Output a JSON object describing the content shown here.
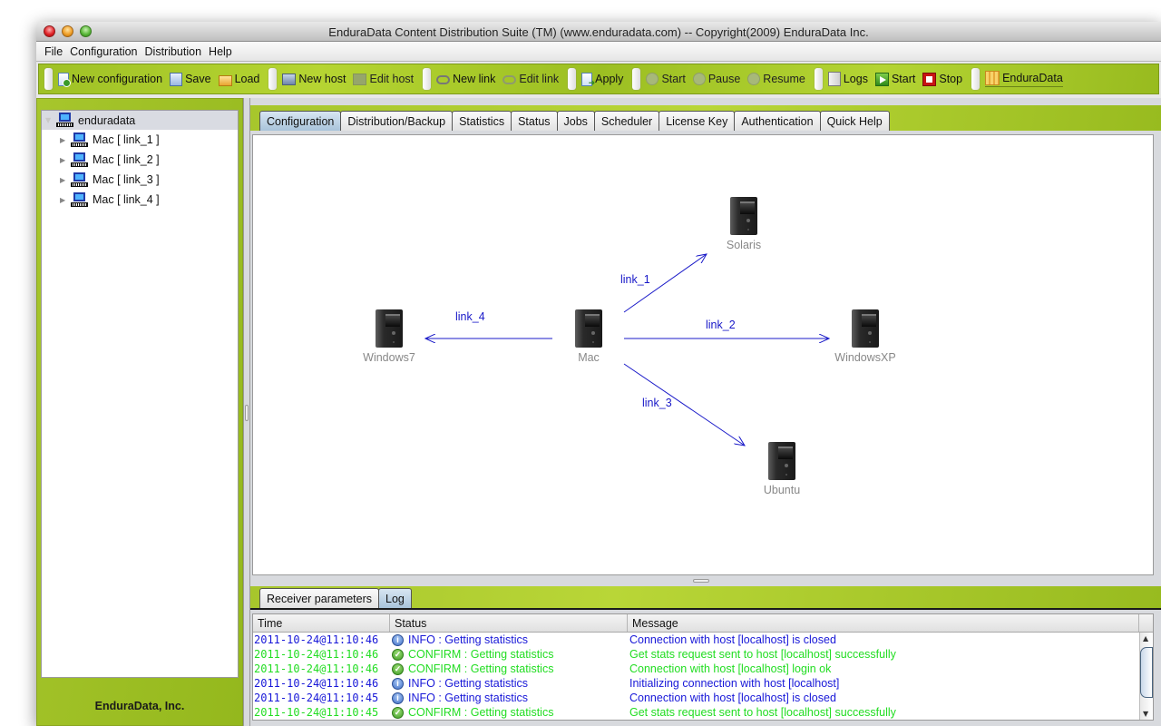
{
  "window": {
    "title": "EnduraData Content Distribution Suite (TM) (www.enduradata.com) -- Copyright(2009) EnduraData Inc."
  },
  "menu": [
    "File",
    "Configuration",
    "Distribution",
    "Help"
  ],
  "toolbar": {
    "groups": [
      [
        {
          "label": "New configuration",
          "icon": "new-document-icon",
          "enabled": true
        },
        {
          "label": "Save",
          "icon": "save-icon",
          "enabled": true
        },
        {
          "label": "Load",
          "icon": "folder-open-icon",
          "enabled": true
        }
      ],
      [
        {
          "label": "New host",
          "icon": "new-host-icon",
          "enabled": true
        },
        {
          "label": "Edit host",
          "icon": "edit-host-icon",
          "enabled": false
        }
      ],
      [
        {
          "label": "New link",
          "icon": "new-link-icon",
          "enabled": true
        },
        {
          "label": "Edit link",
          "icon": "edit-link-icon",
          "enabled": false
        }
      ],
      [
        {
          "label": "Apply",
          "icon": "apply-icon",
          "enabled": true
        }
      ],
      [
        {
          "label": "Start",
          "icon": "start-circle-icon",
          "enabled": false
        },
        {
          "label": "Pause",
          "icon": "pause-circle-icon",
          "enabled": false
        },
        {
          "label": "Resume",
          "icon": "resume-circle-icon",
          "enabled": false
        }
      ],
      [
        {
          "label": "Logs",
          "icon": "logs-icon",
          "enabled": true
        },
        {
          "label": "Start",
          "icon": "play-icon",
          "enabled": true
        },
        {
          "label": "Stop",
          "icon": "stop-icon",
          "enabled": true
        }
      ],
      [
        {
          "label": "EnduraData",
          "icon": "enduradata-logo-icon",
          "enabled": true
        }
      ]
    ]
  },
  "tree": {
    "root": "enduradata",
    "children": [
      "Mac [ link_1 ]",
      "Mac [ link_2 ]",
      "Mac [ link_3 ]",
      "Mac [ link_4 ]"
    ]
  },
  "company": "EnduraData, Inc.",
  "tabs": [
    "Configuration",
    "Distribution/Backup",
    "Statistics",
    "Status",
    "Jobs",
    "Scheduler",
    "License Key",
    "Authentication",
    "Quick Help"
  ],
  "active_tab": "Configuration",
  "diagram": {
    "nodes": [
      {
        "id": "mac",
        "label": "Mac"
      },
      {
        "id": "solaris",
        "label": "Solaris"
      },
      {
        "id": "windowsxp",
        "label": "WindowsXP"
      },
      {
        "id": "ubuntu",
        "label": "Ubuntu"
      },
      {
        "id": "windows7",
        "label": "Windows7"
      }
    ],
    "edges": [
      {
        "label": "link_1",
        "from": "mac",
        "to": "solaris"
      },
      {
        "label": "link_2",
        "from": "mac",
        "to": "windowsxp"
      },
      {
        "label": "link_3",
        "from": "mac",
        "to": "ubuntu"
      },
      {
        "label": "link_4",
        "from": "mac",
        "to": "windows7"
      }
    ],
    "edge_color": "#1818c8"
  },
  "bottom_tabs": [
    "Receiver parameters",
    "Log"
  ],
  "active_bottom_tab": "Log",
  "log": {
    "columns": [
      "Time",
      "Status",
      "Message"
    ],
    "colors": {
      "INFO": "#1818d8",
      "CONFIRM": "#22dd22"
    },
    "rows": [
      {
        "time": "2011-10-24@11:10:46",
        "level": "INFO",
        "status": "INFO : Getting statistics",
        "message": "Connection with host [localhost] is closed"
      },
      {
        "time": "2011-10-24@11:10:46",
        "level": "CONFIRM",
        "status": "CONFIRM : Getting statistics",
        "message": "Get stats request sent to host [localhost] successfully"
      },
      {
        "time": "2011-10-24@11:10:46",
        "level": "CONFIRM",
        "status": "CONFIRM : Getting statistics",
        "message": "Connection with host [localhost] login ok"
      },
      {
        "time": "2011-10-24@11:10:46",
        "level": "INFO",
        "status": "INFO : Getting statistics",
        "message": "Initializing connection with host [localhost]"
      },
      {
        "time": "2011-10-24@11:10:45",
        "level": "INFO",
        "status": "INFO : Getting statistics",
        "message": "Connection with host [localhost] is closed"
      },
      {
        "time": "2011-10-24@11:10:45",
        "level": "CONFIRM",
        "status": "CONFIRM : Getting statistics",
        "message": "Get stats request sent to host [localhost] successfully"
      }
    ]
  }
}
